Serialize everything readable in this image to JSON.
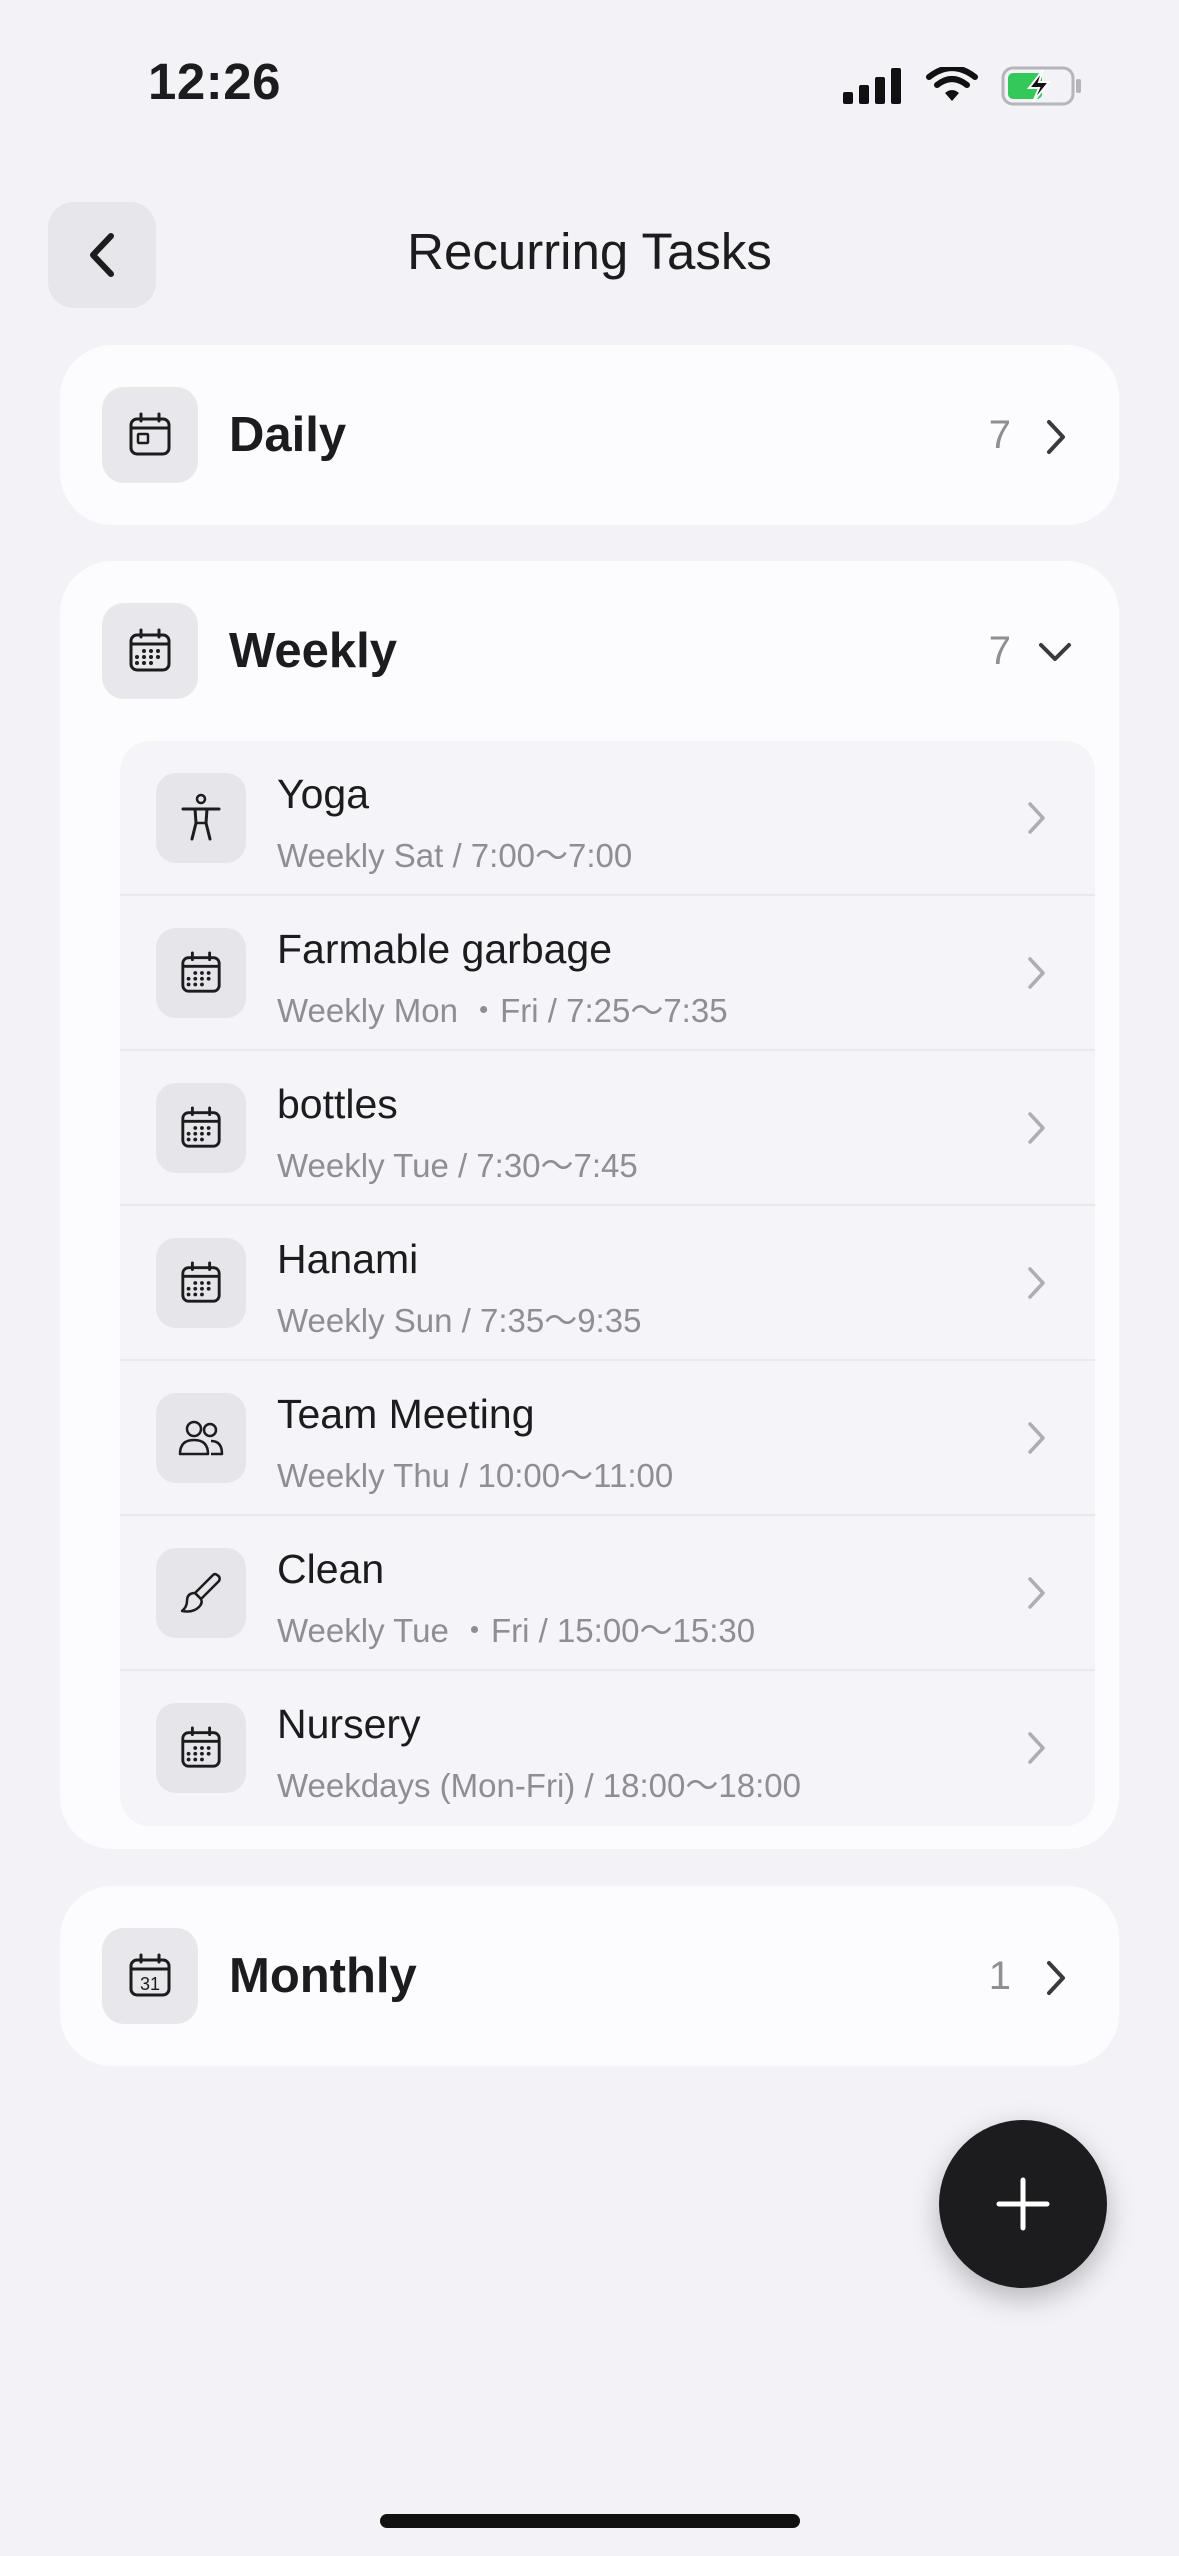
{
  "status_bar": {
    "time": "12:26"
  },
  "header": {
    "title": "Recurring Tasks"
  },
  "categories": {
    "daily": {
      "label": "Daily",
      "count": "7",
      "icon": "calendar-day-icon"
    },
    "weekly": {
      "label": "Weekly",
      "count": "7",
      "icon": "calendar-week-icon"
    },
    "monthly": {
      "label": "Monthly",
      "count": "1",
      "icon": "calendar-31-icon"
    }
  },
  "weekly_tasks": [
    {
      "title": "Yoga",
      "schedule": "Weekly Sat / 7:00～7:00",
      "icon": "figure-stand-icon"
    },
    {
      "title": "Farmable garbage",
      "schedule": "Weekly Mon ・Fri / 7:25～7:35",
      "icon": "calendar-icon"
    },
    {
      "title": "bottles",
      "schedule": "Weekly Tue / 7:30～7:45",
      "icon": "calendar-icon"
    },
    {
      "title": "Hanami",
      "schedule": "Weekly Sun / 7:35～9:35",
      "icon": "calendar-icon"
    },
    {
      "title": "Team Meeting",
      "schedule": "Weekly Thu / 10:00～11:00",
      "icon": "people-icon"
    },
    {
      "title": "Clean",
      "schedule": "Weekly Tue ・Fri / 15:00～15:30",
      "icon": "brush-icon"
    },
    {
      "title": "Nursery",
      "schedule": "Weekdays (Mon-Fri) / 18:00～18:00",
      "icon": "calendar-icon"
    }
  ],
  "colors": {
    "background": "#f2f2f7",
    "card": "#fcfcfe",
    "fab": "#1c1c1e",
    "battery_charging": "#34c759"
  }
}
